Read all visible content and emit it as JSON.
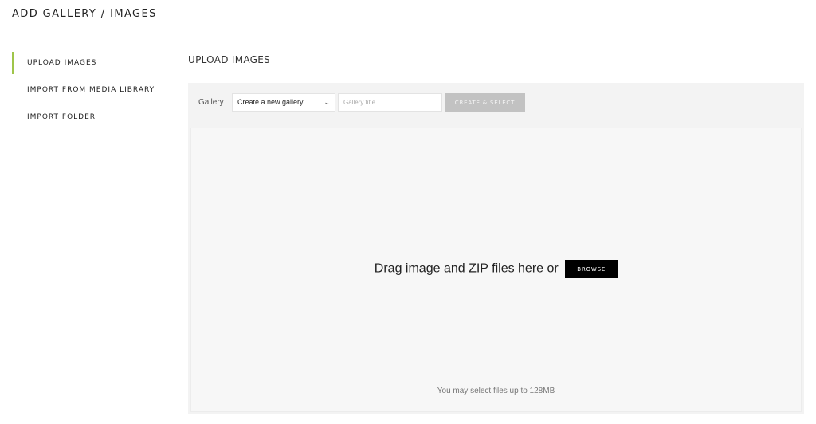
{
  "header": {
    "title": "ADD GALLERY / IMAGES"
  },
  "sidebar": {
    "items": [
      {
        "label": "UPLOAD IMAGES",
        "active": true
      },
      {
        "label": "IMPORT FROM MEDIA LIBRARY",
        "active": false
      },
      {
        "label": "IMPORT FOLDER",
        "active": false
      }
    ],
    "accent_color": "#9fc54a"
  },
  "main": {
    "section_title": "UPLOAD IMAGES",
    "toolbar": {
      "gallery_label": "Gallery",
      "gallery_select_value": "Create a new gallery",
      "gallery_title_placeholder": "Gallery title",
      "gallery_title_value": "",
      "create_button_label": "CREATE & SELECT"
    },
    "dropzone": {
      "prompt_text": "Drag image and ZIP files here or",
      "browse_label": "BROWSE",
      "limit_text": "You may select files up to 128MB"
    }
  }
}
